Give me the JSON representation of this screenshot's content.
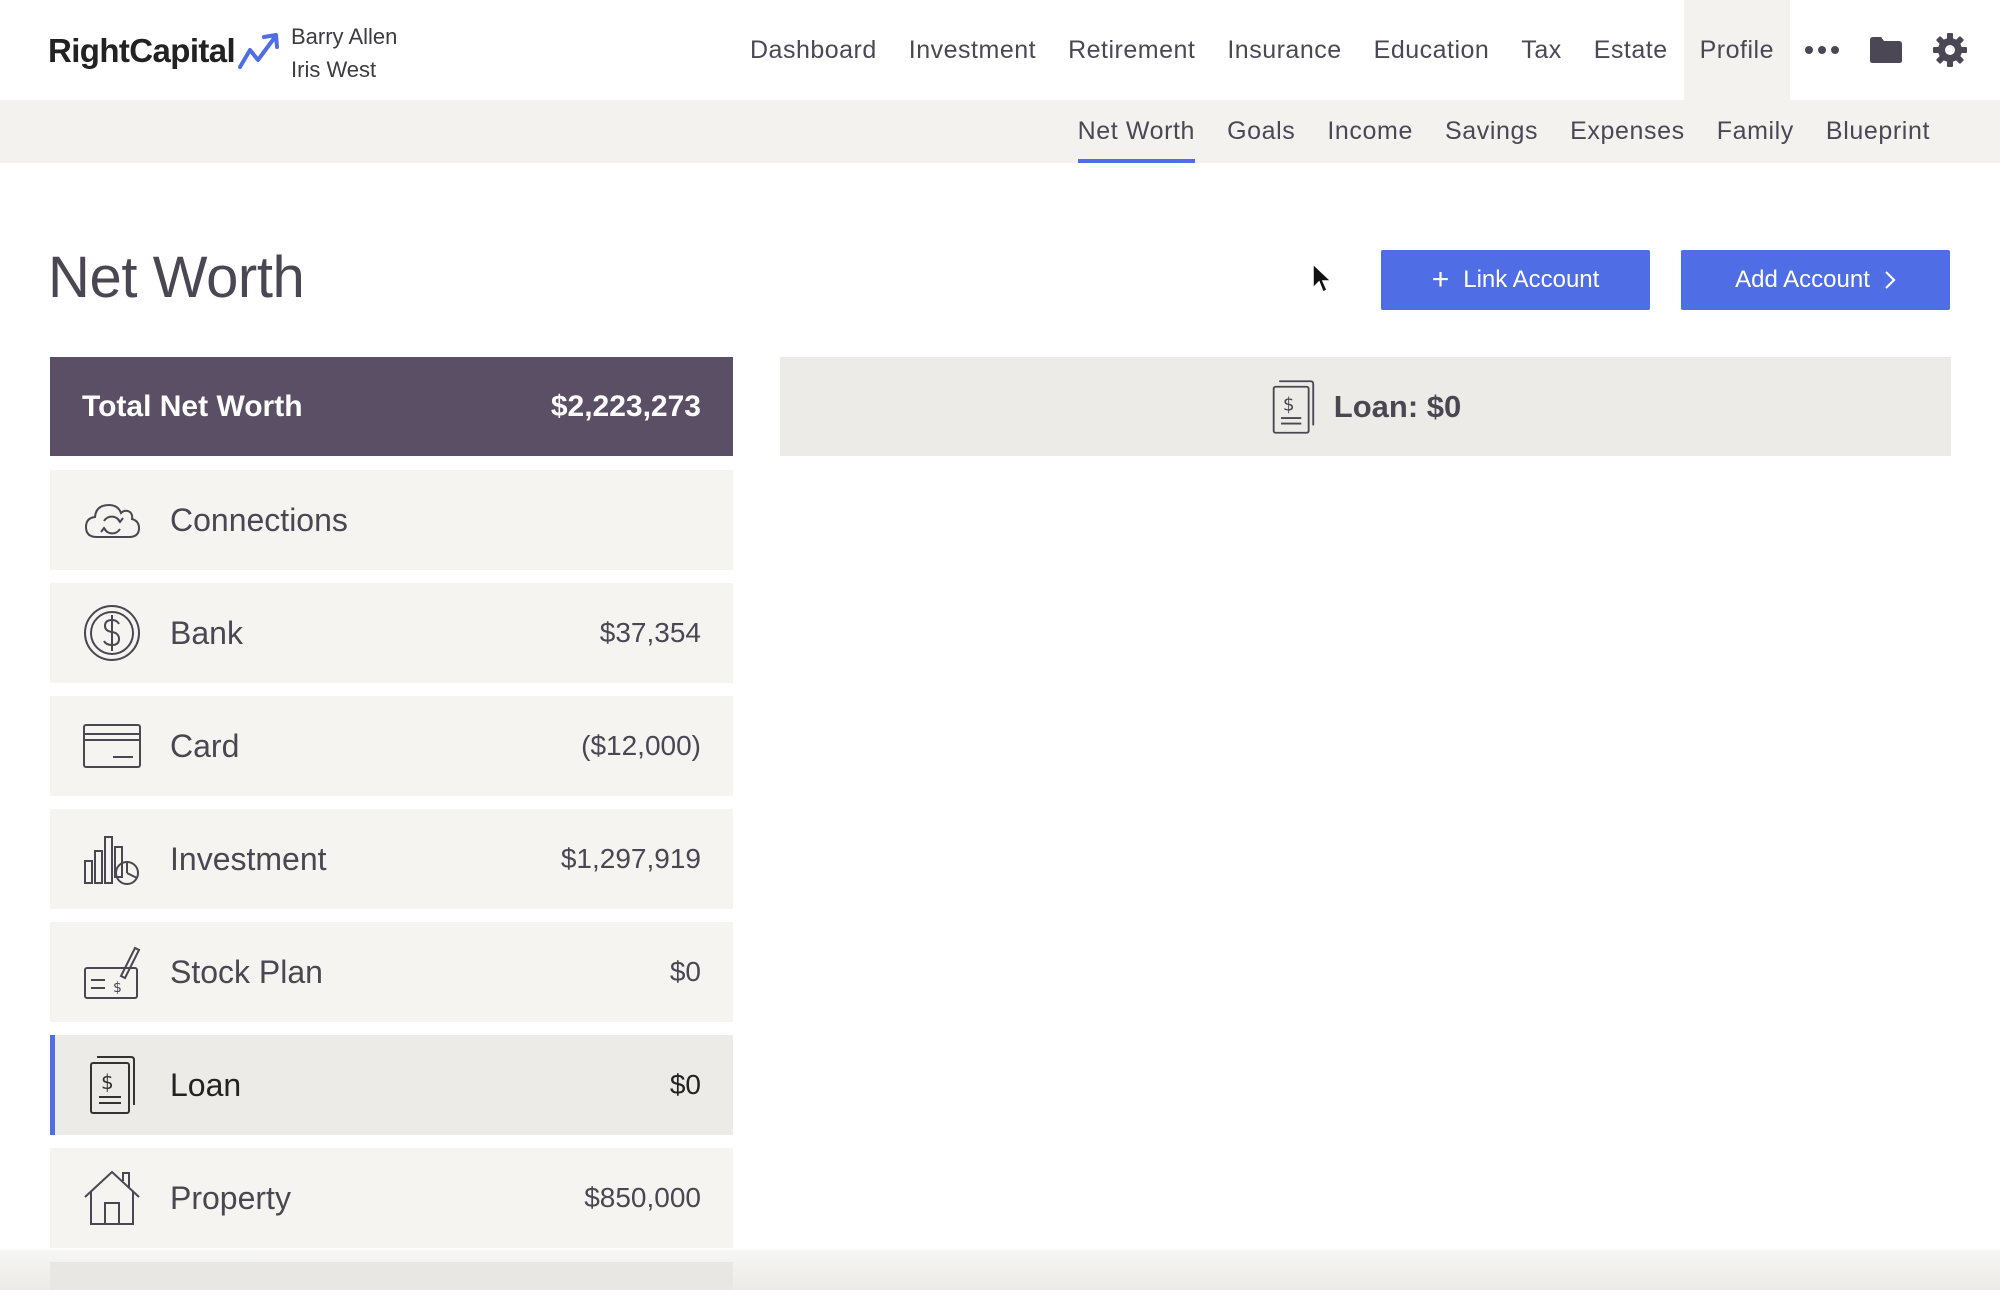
{
  "brand": {
    "name": "RightCapital"
  },
  "clients": {
    "primary": "Barry Allen",
    "secondary": "Iris West"
  },
  "topnav": {
    "items": [
      {
        "label": "Dashboard"
      },
      {
        "label": "Investment"
      },
      {
        "label": "Retirement"
      },
      {
        "label": "Insurance"
      },
      {
        "label": "Education"
      },
      {
        "label": "Tax"
      },
      {
        "label": "Estate"
      },
      {
        "label": "Profile",
        "active": true
      }
    ],
    "icons": [
      "more-icon",
      "folder-icon",
      "gear-icon"
    ]
  },
  "subnav": {
    "items": [
      {
        "label": "Net Worth",
        "active": true
      },
      {
        "label": "Goals"
      },
      {
        "label": "Income"
      },
      {
        "label": "Savings"
      },
      {
        "label": "Expenses"
      },
      {
        "label": "Family"
      },
      {
        "label": "Blueprint"
      }
    ]
  },
  "page": {
    "title": "Net Worth",
    "link_account_label": "Link Account",
    "add_account_label": "Add Account"
  },
  "summary": {
    "label": "Total Net Worth",
    "value": "$2,223,273"
  },
  "accounts": [
    {
      "icon": "cloud-sync-icon",
      "name": "Connections",
      "amount": ""
    },
    {
      "icon": "dollar-coin-icon",
      "name": "Bank",
      "amount": "$37,354"
    },
    {
      "icon": "credit-card-icon",
      "name": "Card",
      "amount": "($12,000)"
    },
    {
      "icon": "bar-pie-chart-icon",
      "name": "Investment",
      "amount": "$1,297,919"
    },
    {
      "icon": "check-pen-icon",
      "name": "Stock Plan",
      "amount": "$0"
    },
    {
      "icon": "loan-document-icon",
      "name": "Loan",
      "amount": "$0",
      "active": true
    },
    {
      "icon": "house-icon",
      "name": "Property",
      "amount": "$850,000"
    }
  ],
  "detail": {
    "icon": "loan-document-icon",
    "title": "Loan: $0"
  },
  "colors": {
    "accent": "#4f6de4",
    "header_dark": "#5b4f65",
    "row_bg": "#f6f4f0",
    "row_active_bg": "#ecebe7"
  }
}
